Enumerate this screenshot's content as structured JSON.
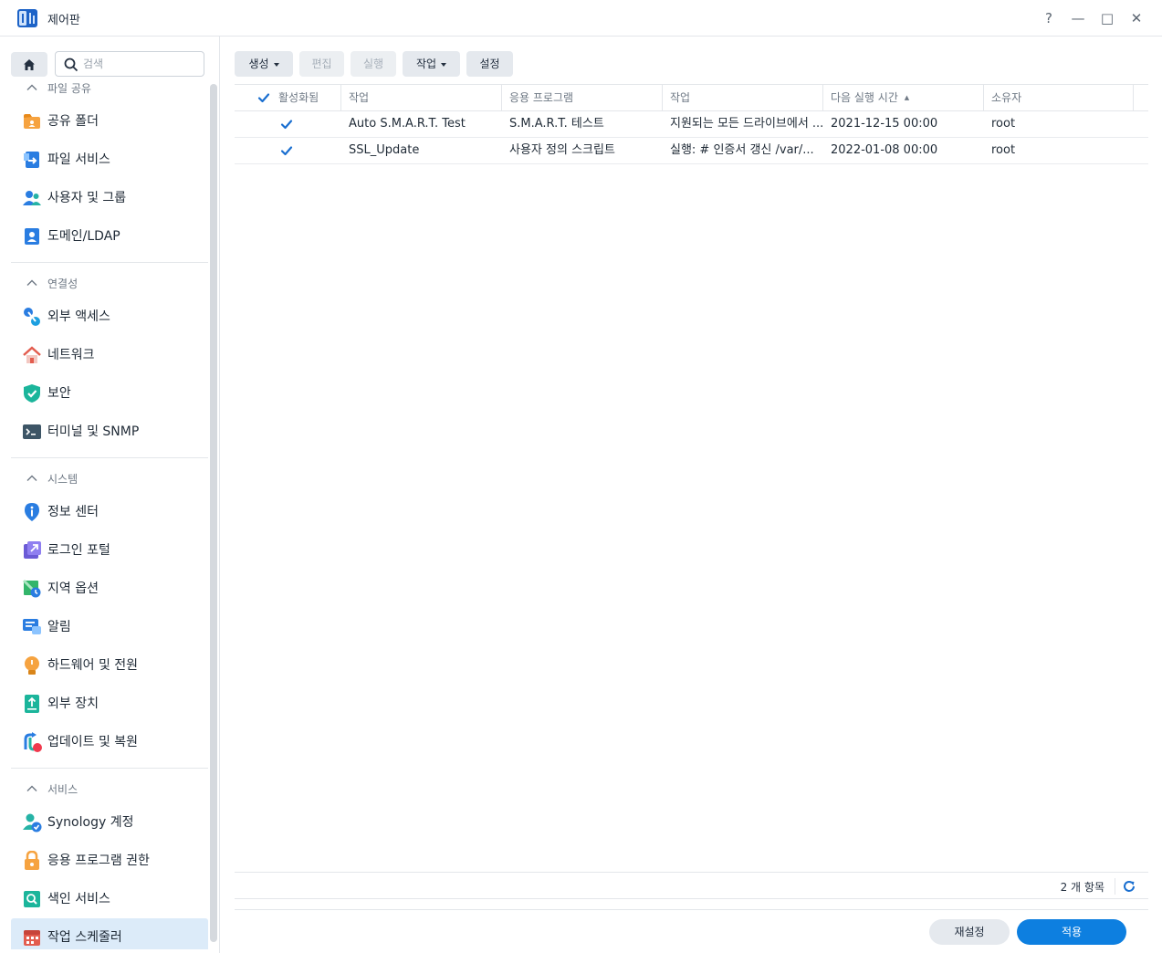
{
  "window": {
    "title": "제어판",
    "help_label": "?",
    "minimize_label": "—",
    "maximize_label": "□",
    "close_label": "✕"
  },
  "search": {
    "placeholder": "검색"
  },
  "sidebar": {
    "sections": [
      {
        "title": "파일 공유",
        "items": [
          {
            "label": "공유 폴더",
            "icon": "shared-folder-icon"
          },
          {
            "label": "파일 서비스",
            "icon": "file-services-icon"
          },
          {
            "label": "사용자 및 그룹",
            "icon": "user-group-icon"
          },
          {
            "label": "도메인/LDAP",
            "icon": "domain-ldap-icon"
          }
        ]
      },
      {
        "title": "연결성",
        "items": [
          {
            "label": "외부 액세스",
            "icon": "external-access-icon"
          },
          {
            "label": "네트워크",
            "icon": "network-icon"
          },
          {
            "label": "보안",
            "icon": "security-shield-icon"
          },
          {
            "label": "터미널 및 SNMP",
            "icon": "terminal-icon"
          }
        ]
      },
      {
        "title": "시스템",
        "items": [
          {
            "label": "정보 센터",
            "icon": "info-center-icon"
          },
          {
            "label": "로그인 포털",
            "icon": "login-portal-icon"
          },
          {
            "label": "지역 옵션",
            "icon": "regional-options-icon"
          },
          {
            "label": "알림",
            "icon": "notification-icon"
          },
          {
            "label": "하드웨어 및 전원",
            "icon": "hardware-power-icon"
          },
          {
            "label": "외부 장치",
            "icon": "external-devices-icon"
          },
          {
            "label": "업데이트 및 복원",
            "icon": "update-restore-icon"
          }
        ]
      },
      {
        "title": "서비스",
        "items": [
          {
            "label": "Synology 계정",
            "icon": "synology-account-icon"
          },
          {
            "label": "응용 프로그램 권한",
            "icon": "application-privileges-icon"
          },
          {
            "label": "색인 서비스",
            "icon": "indexing-service-icon"
          },
          {
            "label": "작업 스케줄러",
            "icon": "task-scheduler-icon",
            "active": true
          }
        ]
      }
    ]
  },
  "toolbar": {
    "create": "생성",
    "edit": "편집",
    "run": "실행",
    "action": "작업",
    "settings": "설정"
  },
  "table": {
    "columns": [
      "활성화됨",
      "작업",
      "응용 프로그램",
      "작업",
      "다음 실행 시간",
      "소유자"
    ],
    "sort_indicator": "▲",
    "rows": [
      {
        "enabled": true,
        "task": "Auto S.M.A.R.T. Test",
        "application": "S.M.A.R.T. 테스트",
        "action": "지원되는 모든 드라이브에서 ...",
        "next_run": "2021-12-15 00:00",
        "owner": "root"
      },
      {
        "enabled": true,
        "task": "SSL_Update",
        "application": "사용자 정의 스크립트",
        "action": "실행: # 인증서 갱신 /var/...",
        "next_run": "2022-01-08 00:00",
        "owner": "root"
      }
    ]
  },
  "footer": {
    "count": "2 개 항목",
    "reset": "재설정",
    "apply": "적용"
  },
  "colors": {
    "accent": "#0d7fe0",
    "active_bg": "#dcebf9",
    "check": "#1a6fd0"
  }
}
